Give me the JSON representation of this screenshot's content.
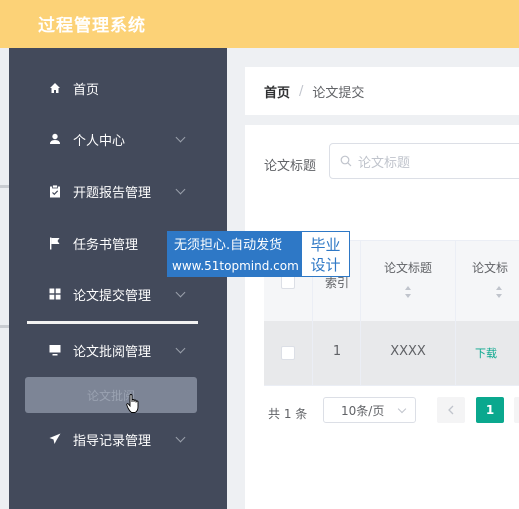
{
  "app_title": "过程管理系统",
  "sidebar": {
    "items": [
      {
        "label": "首页",
        "icon": "home-icon",
        "has_arrow": false
      },
      {
        "label": "个人中心",
        "icon": "user-icon",
        "has_arrow": true
      },
      {
        "label": "开题报告管理",
        "icon": "clipboard-icon",
        "has_arrow": true
      },
      {
        "label": "任务书管理",
        "icon": "flag-icon",
        "has_arrow": true
      },
      {
        "label": "论文提交管理",
        "icon": "grid-icon",
        "has_arrow": true
      },
      {
        "label": "论文批阅管理",
        "icon": "monitor-icon",
        "has_arrow": true
      },
      {
        "label": "指导记录管理",
        "icon": "send-icon",
        "has_arrow": true
      }
    ],
    "submenu_item": "论文批阅"
  },
  "breadcrumb": {
    "home": "首页",
    "separator": "/",
    "current": "论文提交"
  },
  "search": {
    "label": "论文标题",
    "placeholder": "论文标题"
  },
  "table": {
    "columns": [
      "索引",
      "论文标题",
      "论文标"
    ],
    "rows": [
      {
        "index": "1",
        "title": "XXXX",
        "file": "下载"
      }
    ]
  },
  "pagination": {
    "total": "共 1 条",
    "page_size": "10条/页",
    "current_page": "1"
  },
  "watermark": {
    "line1": "无须担心.自动发货",
    "line2": "www.51topmind.com",
    "right1": "毕业",
    "right2": "设计"
  },
  "colors": {
    "header": "#fcd277",
    "sidebar": "#434a5b",
    "accent": "#0aa88e",
    "watermark_blue": "#2e78c6"
  }
}
